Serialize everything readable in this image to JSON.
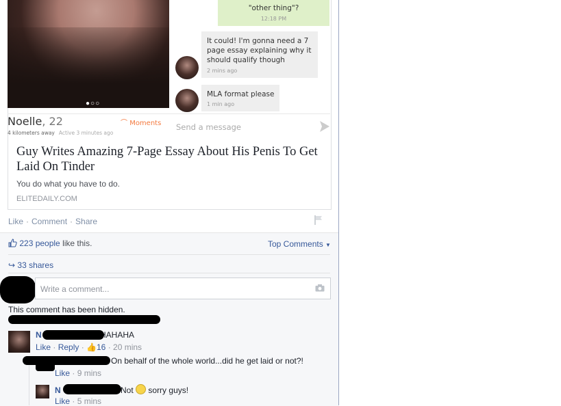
{
  "tinder": {
    "green_bubble_line2": "\"other thing\"?",
    "green_bubble_time": "12:18 PM",
    "bubble1_text": "It could! I'm gonna need a 7 page essay explaining why it should qualify though",
    "bubble1_time": "2 mins ago",
    "bubble2_text": "MLA format please",
    "bubble2_time": "1 min ago",
    "profile_name": "Noelle",
    "profile_age": "22",
    "distance": "4 kilometers away",
    "active": "Active 3 minutes ago",
    "moments_label": "Moments",
    "send_placeholder": "Send a message",
    "photo_dots": "●○○"
  },
  "article": {
    "headline": "Guy Writes Amazing 7-Page Essay About His Penis To Get Laid On Tinder",
    "description": "You do what you have to do.",
    "domain": "ELITEDAILY.COM"
  },
  "post_actions": {
    "like": "Like",
    "comment": "Comment",
    "share": "Share",
    "sep": "·"
  },
  "ufi": {
    "likes_count": "223 people",
    "likes_suffix": " like this.",
    "top_comments": "Top Comments",
    "shares": "33 shares",
    "comment_placeholder": "Write a comment..."
  },
  "comments": {
    "hidden_notice": "This comment has been hidden.",
    "c1_name_start": "N",
    "c1_text": "HAHAHA",
    "c1_like": "Like",
    "c1_reply": "Reply",
    "c1_likes": "16",
    "c1_time": "20 mins",
    "c2_text": "On behalf of the whole world...did he get laid or not?!",
    "c2_like": "Like",
    "c2_time": "9 mins",
    "c3_name_start": "N",
    "c3_text_a": "Not",
    "c3_text_b": "sorry guys!",
    "c3_like": "Like",
    "c3_time": "5 mins"
  },
  "colors": {
    "link": "#365899",
    "moments": "#f47a3f",
    "tinder_green_bubble": "#dff0c9"
  }
}
